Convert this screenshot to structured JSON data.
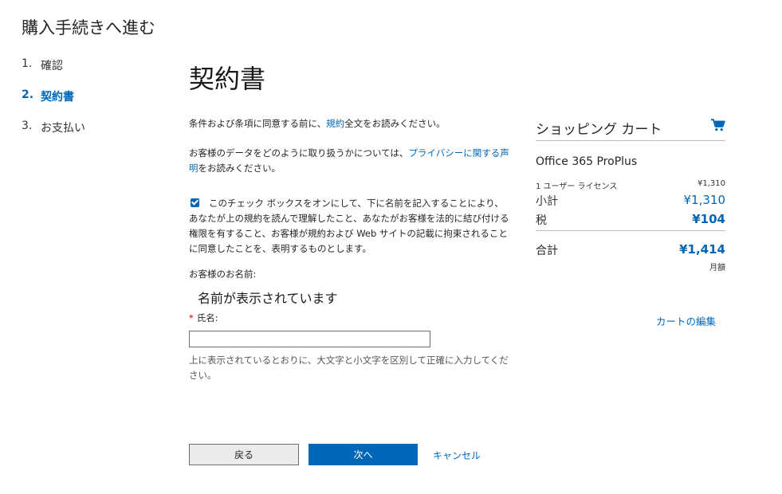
{
  "header": {
    "title": "購入手続きへ進む"
  },
  "steps": [
    {
      "num": "1.",
      "label": "確認",
      "active": false
    },
    {
      "num": "2.",
      "label": "契約書",
      "active": true
    },
    {
      "num": "3.",
      "label": "お支払い",
      "active": false
    }
  ],
  "main": {
    "title": "契約書",
    "terms": {
      "before": "条件および条項に同意する前に、",
      "link": "規約",
      "after": "全文をお読みください。"
    },
    "privacy": {
      "before": "お客様のデータをどのように取り扱うかについては、",
      "link": "プライバシーに関する声明",
      "after": "をお読みください。"
    },
    "consent": {
      "checked": true,
      "text": "このチェック ボックスをオンにして、下に名前を記入することにより、あなたが上の規約を読んで理解したこと、あなたがお客様を法的に結び付ける権限を有すること、お客様が規約および Web サイトの記載に拘束されることに同意したことを、表明するものとします。"
    },
    "customer_name_label": "お客様のお名前:",
    "customer_name_value": "名前が表示されています",
    "name_field": {
      "required_mark": "*",
      "label": "氏名:",
      "value": "",
      "placeholder": ""
    },
    "hint": "上に表示されているとおりに、大文字と小文字を区別して正確に入力してください。"
  },
  "buttons": {
    "back": "戻る",
    "next": "次へ",
    "cancel": "キャンセル"
  },
  "cart": {
    "title": "ショッピング カート",
    "icon": "shopping-cart-icon",
    "product": "Office 365 ProPlus",
    "license_label": "1 ユーザー ライセンス",
    "license_price": "¥1,310",
    "subtotal_label": "小計",
    "subtotal_value": "¥1,310",
    "tax_label": "税",
    "tax_value": "¥104",
    "total_label": "合計",
    "total_value": "¥1,414",
    "period": "月額",
    "edit_link": "カートの編集"
  },
  "colors": {
    "accent": "#0067b8",
    "text": "#262626",
    "button_secondary_bg": "#ebebeb"
  }
}
